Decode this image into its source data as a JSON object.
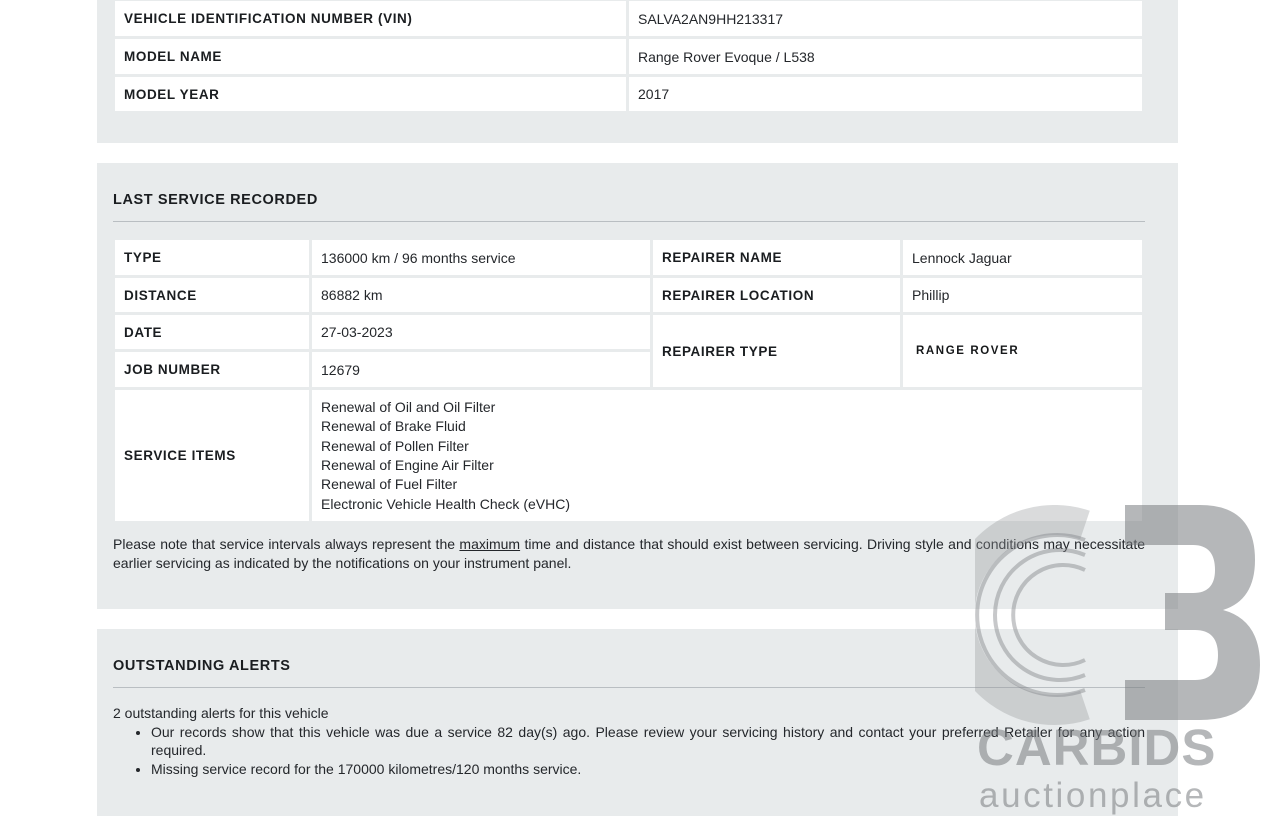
{
  "vehicle": {
    "rows": [
      {
        "label": "VEHICLE IDENTIFICATION NUMBER (VIN)",
        "value": "SALVA2AN9HH213317"
      },
      {
        "label": "MODEL NAME",
        "value": "Range Rover Evoque / L538"
      },
      {
        "label": "MODEL YEAR",
        "value": "2017"
      }
    ]
  },
  "service": {
    "heading": "LAST SERVICE RECORDED",
    "type_label": "TYPE",
    "type_value": "136000 km / 96 months service",
    "distance_label": "DISTANCE",
    "distance_value": "86882 km",
    "date_label": "DATE",
    "date_value": "27-03-2023",
    "job_label": "JOB NUMBER",
    "job_value": "12679",
    "repairer_name_label": "REPAIRER NAME",
    "repairer_name_value": "Lennock Jaguar",
    "repairer_location_label": "REPAIRER LOCATION",
    "repairer_location_value": "Phillip",
    "repairer_type_label": "REPAIRER TYPE",
    "repairer_type_logo": "RANGE ROVER",
    "items_label": "SERVICE ITEMS",
    "items": [
      "Renewal of Oil and Oil Filter",
      "Renewal of Brake Fluid",
      "Renewal of Pollen Filter",
      "Renewal of Engine Air Filter",
      "Renewal of Fuel Filter",
      "Electronic Vehicle Health Check (eVHC)"
    ],
    "note_before": "Please note that service intervals always represent the ",
    "note_link": "maximum",
    "note_after": " time and distance that should exist between servicing. Driving style and conditions may necessitate earlier servicing as indicated by the notifications on your instrument panel."
  },
  "alerts": {
    "heading": "OUTSTANDING ALERTS",
    "summary": "2 outstanding alerts for this vehicle",
    "items": [
      "Our records show that this vehicle was due a service 82 day(s) ago. Please review your servicing history and contact your preferred Retailer for any action required.",
      "Missing service record for the 170000 kilometres/120 months service."
    ]
  },
  "watermark": {
    "brand": "CARBIDS",
    "tagline": "auctionplace"
  }
}
